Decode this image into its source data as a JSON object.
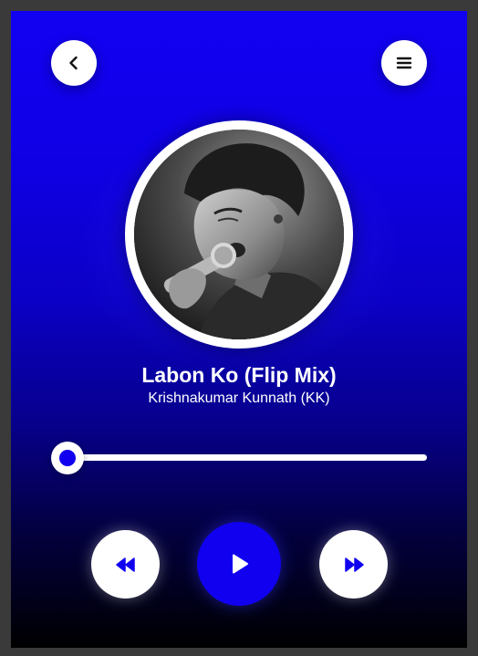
{
  "navigation": {
    "back_icon": "chevron-left-icon",
    "menu_icon": "hamburger-menu-icon"
  },
  "track": {
    "title": "Labon Ko (Flip Mix)",
    "artist": "Krishnakumar Kunnath (KK)",
    "progress": 0.0
  },
  "controls": {
    "rewind_icon": "rewind-icon",
    "play_icon": "play-icon",
    "forward_icon": "fast-forward-icon"
  },
  "colors": {
    "accent": "#1000ef",
    "background_top": "#1200f2",
    "background_bottom": "#000000",
    "button_face": "#ffffff"
  }
}
